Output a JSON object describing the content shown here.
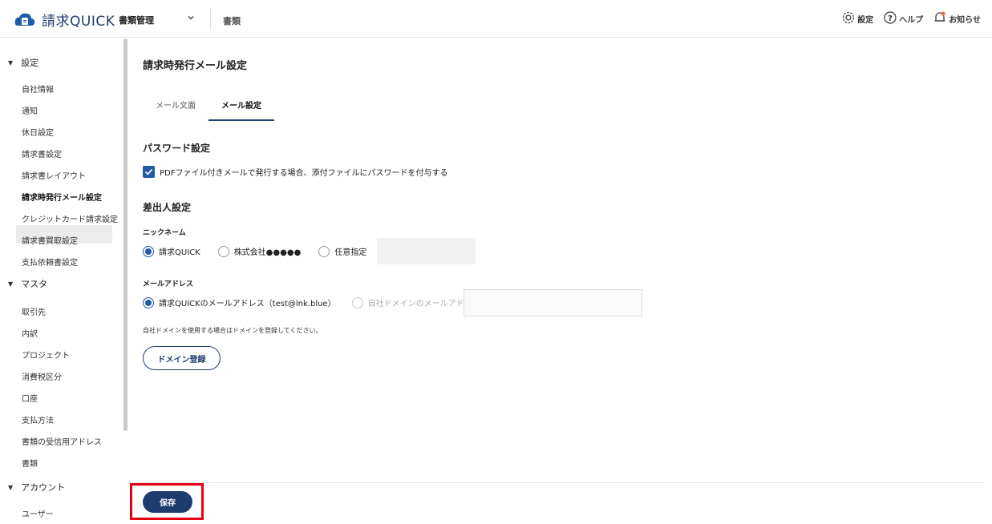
{
  "header": {
    "logo_text": "請求QUICK",
    "section": "書類管理",
    "doc_link": "書類",
    "settings_label": "設定",
    "help_label": "ヘルプ",
    "notice_label": "お知らせ"
  },
  "sidebar": {
    "groups": [
      {
        "label": "設定"
      },
      {
        "label": "マスタ"
      },
      {
        "label": "アカウント"
      }
    ],
    "settings_items": [
      "自社情報",
      "通知",
      "休日設定",
      "請求書設定",
      "請求書レイアウト",
      "請求時発行メール設定",
      "クレジットカード請求設定",
      "請求書買取設定",
      "支払依頼書設定"
    ],
    "master_items": [
      "取引先",
      "内訳",
      "プロジェクト",
      "消費税区分",
      "口座",
      "支払方法",
      "書類の受信用アドレス",
      "書類"
    ],
    "account_items": [
      "ユーザー"
    ]
  },
  "main": {
    "title": "請求時発行メール設定",
    "tabs": [
      {
        "label": "メール文面"
      },
      {
        "label": "メール設定"
      }
    ],
    "password_section": "パスワード設定",
    "password_checkbox_label": "PDFファイル付きメールで発行する場合、添付ファイルにパスワードを付与する",
    "sender_section": "差出人設定",
    "nickname_label": "ニックネーム",
    "nickname_options": [
      "請求QUICK",
      "株式会社●●●●●",
      "任意指定"
    ],
    "email_label": "メールアドレス",
    "email_options": [
      "請求QUICKのメールアドレス（test@lnk.blue）",
      "自社ドメインのメールアドレス"
    ],
    "domain_note": "自社ドメインを使用する場合はドメインを登録してください。",
    "domain_button": "ドメイン登録",
    "save_button": "保存"
  },
  "colors": {
    "brand": "#1f3c6e",
    "accent": "#1f5aa8",
    "highlight": "#e60012"
  }
}
